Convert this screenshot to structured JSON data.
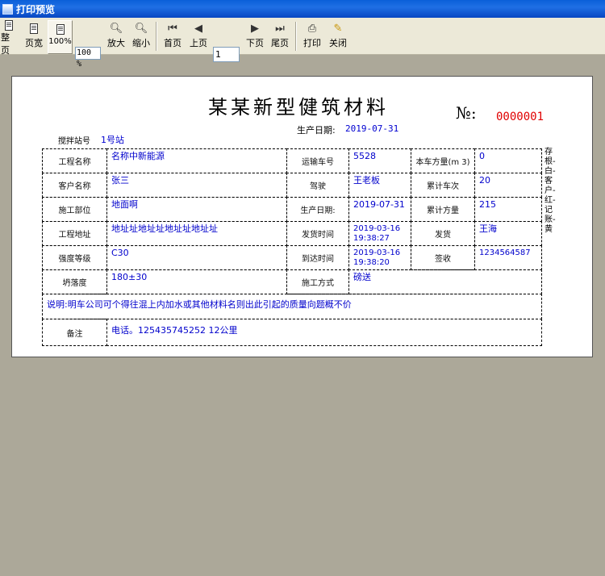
{
  "window": {
    "title": "打印预览"
  },
  "toolbar": {
    "whole_page": "整页",
    "page_width": "页宽",
    "hundred": "100%",
    "zoom_value": "100 %",
    "zoom_in": "放大",
    "zoom_out": "缩小",
    "first_page": "首页",
    "prev_page": "上页",
    "page_number": "1",
    "next_page": "下页",
    "last_page": "尾页",
    "print": "打印",
    "close": "关闭"
  },
  "document": {
    "title": "某某新型健筑材料",
    "number_label": "№:",
    "number_value": "0000001",
    "production_date_label": "生产日期:",
    "production_date_value": "2019-07-31",
    "station_label": "搅拌站号",
    "station_value": "1号站",
    "side_copy": "存根-白-客户-红-记账-黄",
    "fields": {
      "project_name_label": "工程名称",
      "project_name": "名称中新能源",
      "truck_no_label": "运输车号",
      "truck_no": "5528",
      "load_volume_label": "本车方量(m 3)",
      "load_volume": "0",
      "customer_label": "客户名称",
      "customer": "张三",
      "driver_label": "驾驶",
      "driver": "王老板",
      "trips_label": "累计车次",
      "trips": "20",
      "site_label": "施工部位",
      "site": "地面啊",
      "prod_date_label": "生产日期:",
      "prod_date": "2019-07-31",
      "total_volume_label": "累计方量",
      "total_volume": "215",
      "address_label": "工程地址",
      "address": "地址址地址址地址址地址址",
      "depart_time_label": "发货时间",
      "depart_time": "2019-03-16 19:38:27",
      "shipper_label": "发货",
      "shipper": "王海",
      "strength_label": "强度等级",
      "strength": "C30",
      "arrive_time_label": "到达时间",
      "arrive_time": "2019-03-16 19:38:20",
      "signer_label": "签收",
      "signer": "1234564587",
      "slump_label": "坍落度",
      "slump": "180±30",
      "method_label": "施工方式",
      "method": "磅送",
      "note": "说明:明车公司可个得往混上内加水或其他材料名则出此引起的质量向题概不价",
      "remark_label": "备注",
      "remark": "电话。125435745252 12公里"
    }
  },
  "colors": {
    "titlebar": "#0a5fd8",
    "value_text": "#0000cc",
    "number_red": "#e00000",
    "workspace": "#aca899"
  }
}
